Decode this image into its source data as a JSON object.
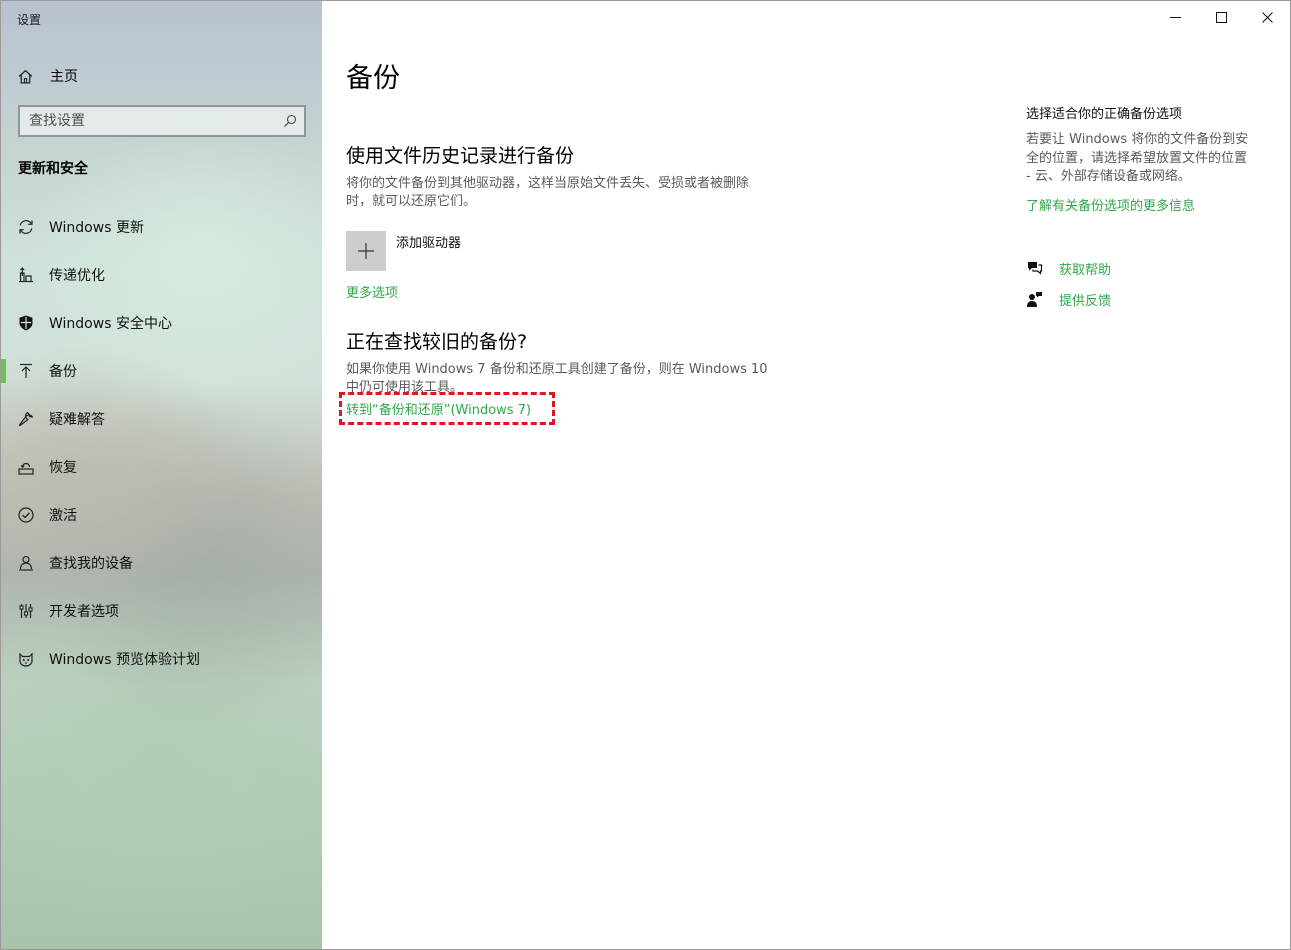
{
  "app_title": "设置",
  "sidebar": {
    "home_label": "主页",
    "search_placeholder": "查找设置",
    "section_title": "更新和安全",
    "items": [
      {
        "label": "Windows 更新",
        "icon": "refresh-icon"
      },
      {
        "label": "传递优化",
        "icon": "delivery-optimization-icon"
      },
      {
        "label": "Windows 安全中心",
        "icon": "shield-icon"
      },
      {
        "label": "备份",
        "icon": "backup-arrow-icon",
        "selected": true
      },
      {
        "label": "疑难解答",
        "icon": "wrench-icon"
      },
      {
        "label": "恢复",
        "icon": "recovery-icon"
      },
      {
        "label": "激活",
        "icon": "check-circle-icon"
      },
      {
        "label": "查找我的设备",
        "icon": "person-location-icon"
      },
      {
        "label": "开发者选项",
        "icon": "developer-sliders-icon"
      },
      {
        "label": "Windows 预览体验计划",
        "icon": "insider-cat-icon"
      }
    ]
  },
  "main": {
    "title": "备份",
    "file_history": {
      "heading": "使用文件历史记录进行备份",
      "desc_line1": "将你的文件备份到其他驱动器，这样当原始文件丢失、受损或者被删除",
      "desc_line2": "时，就可以还原它们。",
      "add_drive_label": "添加驱动器",
      "more_options": "更多选项"
    },
    "older_backup": {
      "heading": "正在查找较旧的备份?",
      "desc_line1": "如果你使用 Windows 7 备份和还原工具创建了备份，则在 Windows 10",
      "desc_line2": "中仍可使用该工具。",
      "link": "转到“备份和还原”(Windows 7)"
    }
  },
  "right_panel": {
    "title": "选择适合你的正确备份选项",
    "text_line1": "若要让 Windows 将你的文件备份到安",
    "text_line2": "全的位置，请选择希望放置文件的位置",
    "text_line3": "- 云、外部存储设备或网络。",
    "learn_more": "了解有关备份选项的更多信息",
    "get_help": "获取帮助",
    "feedback": "提供反馈"
  },
  "colors": {
    "accent_green": "#2fa84a",
    "selection_bar": "#6cc24a",
    "highlight_red": "#e0161e"
  }
}
